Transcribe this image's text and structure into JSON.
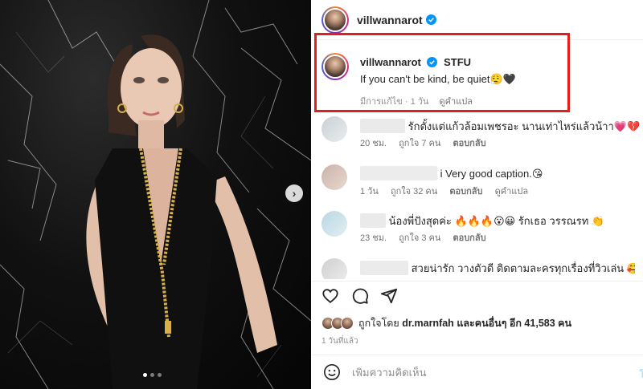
{
  "photo": {
    "next_icon": "chevron-right-icon",
    "carousel_dots": 3,
    "active_dot": 1
  },
  "header": {
    "username": "villwannarot",
    "verified": true
  },
  "caption": {
    "username": "villwannarot",
    "title": "STFU",
    "text": "If you can't be kind, be quiet😮‍💨🖤",
    "edited": "มีการแก้ไข · 1 วัน",
    "see_translation": "ดูคำแปล"
  },
  "comments": [
    {
      "text": "รักตั้งแต่แก้วล้อมเพชรอะ นานเท่าไหร่แล้วน้าา💗💔",
      "time": "20 ชม.",
      "likes": "ถูกใจ 7 คน",
      "reply": "ตอบกลับ",
      "translate": ""
    },
    {
      "text": "i Very good caption.😘",
      "time": "1 วัน",
      "likes": "ถูกใจ 32 คน",
      "reply": "ตอบกลับ",
      "translate": "ดูคำแปล"
    },
    {
      "text": "น้องพี่ปังสุดค่ะ 🔥🔥🔥😮😀 รักเธอ วรรณรท 👏",
      "time": "23 ชม.",
      "likes": "ถูกใจ 3 คน",
      "reply": "ตอบกลับ",
      "translate": ""
    },
    {
      "text": "สวยน่ารัก วางตัวดี ติดตามละครทุกเรื่องที่วิวเล่น 🥰",
      "time": "",
      "likes": "",
      "reply": "",
      "translate": ""
    }
  ],
  "actions": {
    "like_icon": "heart-outline-icon",
    "comment_icon": "comment-bubble-icon",
    "share_icon": "send-paper-plane-icon"
  },
  "likes": {
    "liked_by_prefix": "ถูกใจโดย",
    "liked_by_user": "dr.marnfah",
    "others_text": "และคนอื่นๆ อีก 41,583 คน"
  },
  "time_ago": "1 วันที่แล้ว",
  "add_comment": {
    "placeholder": "เพิ่มความคิดเห็น",
    "emoji_icon": "smiley-face-icon",
    "post_label": "โ"
  },
  "colors": {
    "highlight_border": "#e0201f",
    "verified_blue": "#0095f6",
    "muted_text": "#737373"
  }
}
